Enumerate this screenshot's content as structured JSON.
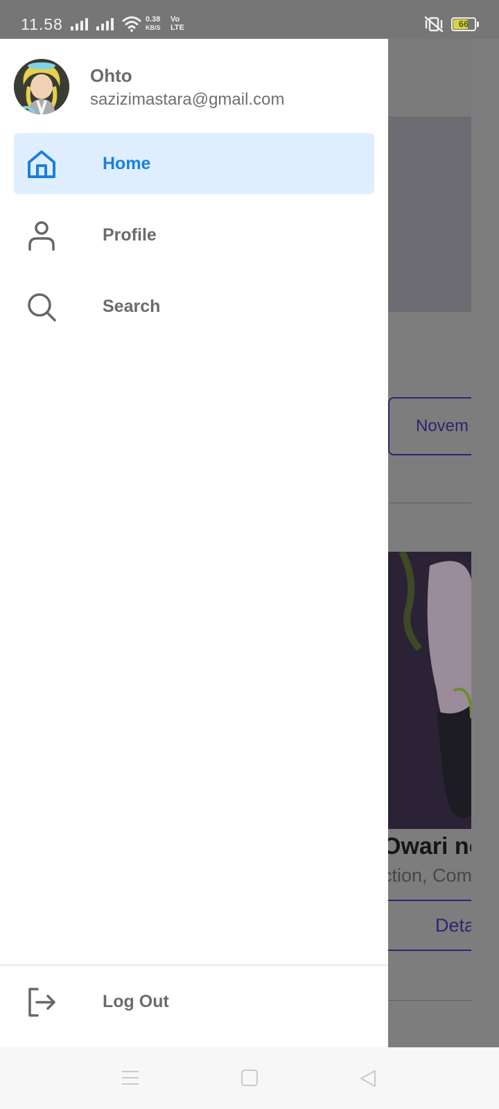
{
  "status_bar": {
    "time": "11.58",
    "net_speed_value": "0.38",
    "net_speed_unit": "KB/S",
    "volte_top": "Vo",
    "volte_bottom": "LTE",
    "battery": "66",
    "battery_level": 0.66,
    "icons": [
      "signal-icon",
      "signal-icon",
      "wifi-icon",
      "vibrate-off-icon",
      "battery-icon"
    ]
  },
  "drawer": {
    "user": {
      "name": "Ohto",
      "email": "sazizimastara@gmail.com"
    },
    "items": [
      {
        "label": "Home",
        "icon": "home-icon",
        "active": true
      },
      {
        "label": "Profile",
        "icon": "person-icon",
        "active": false
      },
      {
        "label": "Search",
        "icon": "search-icon",
        "active": false
      }
    ],
    "logout": {
      "label": "Log Out",
      "icon": "logout-icon"
    }
  },
  "background": {
    "chip": "Novem",
    "title": "Owari no",
    "genres": "ction, Come",
    "detail_button": "Deta"
  },
  "nav_bar": {
    "icons": [
      "menu-icon",
      "home-square-icon",
      "back-icon"
    ]
  },
  "colors": {
    "accent": "#1b7fe0",
    "active_bg": "#dfeefe",
    "text_gray": "#6b6b6b",
    "chip_purple": "#2c2470"
  }
}
